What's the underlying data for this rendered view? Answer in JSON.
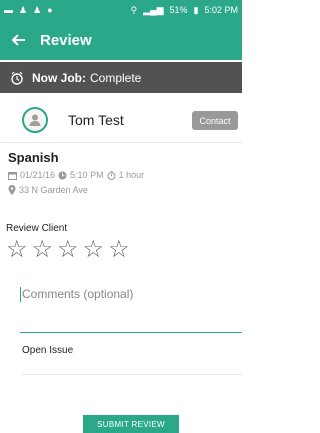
{
  "status_bar": {
    "battery": "51%",
    "time": "5:02 PM"
  },
  "header": {
    "title": "Review"
  },
  "job_status": {
    "prefix": "Now Job:",
    "value": "Complete"
  },
  "client": {
    "name": "Tom Test",
    "contact_label": "Contact"
  },
  "job": {
    "title": "Spanish",
    "date": "01/21/16",
    "time": "5:10 PM",
    "duration": "1 hour",
    "address": "33 N Garden Ave"
  },
  "review": {
    "label": "Review Client",
    "stars": [
      "☆",
      "☆",
      "☆",
      "☆",
      "☆"
    ],
    "comments_placeholder": "Comments (optional)",
    "open_issue_label": "Open Issue",
    "submit_label": "SUBMIT REVIEW"
  },
  "colors": {
    "accent": "#2aa889",
    "job_bar": "#525252"
  }
}
